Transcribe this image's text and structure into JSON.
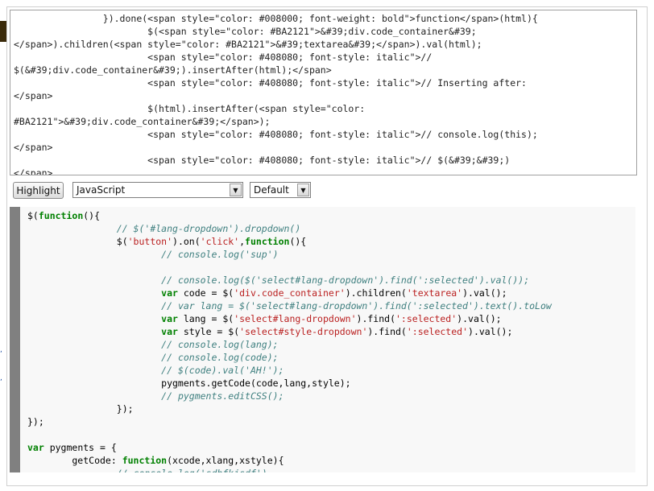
{
  "raw_html_lines": [
    "                }).done(<span style=\"color: #008000; font-weight: bold\">function</span>(html){",
    "                        $(<span style=\"color: #BA2121\">&#39;div.code_container&#39;",
    "</span>).children(<span style=\"color: #BA2121\">&#39;textarea&#39;</span>).val(html);",
    "                        <span style=\"color: #408080; font-style: italic\">//",
    "$(&#39;div.code_container&#39;).insertAfter(html);</span>",
    "                        <span style=\"color: #408080; font-style: italic\">// Inserting after:",
    "</span>",
    "                        $(html).insertAfter(<span style=\"color:",
    "#BA2121\">&#39;div.code_container&#39;</span>);",
    "                        <span style=\"color: #408080; font-style: italic\">// console.log(this);",
    "</span>",
    "                        <span style=\"color: #408080; font-style: italic\">// $(&#39;&#39;)",
    "</span>"
  ],
  "controls": {
    "highlight_label": "Highlight",
    "language_selected": "JavaScript",
    "style_selected": "Default"
  },
  "code_lines": [
    [
      {
        "t": "$("
      },
      {
        "t": "function",
        "c": "kw"
      },
      {
        "t": "(){"
      }
    ],
    [
      {
        "t": "                "
      },
      {
        "t": "// $('#lang-dropdown').dropdown()",
        "c": "cm"
      }
    ],
    [
      {
        "t": "                $("
      },
      {
        "t": "'button'",
        "c": "st"
      },
      {
        "t": ").on("
      },
      {
        "t": "'click'",
        "c": "st"
      },
      {
        "t": ","
      },
      {
        "t": "function",
        "c": "kw"
      },
      {
        "t": "(){"
      }
    ],
    [
      {
        "t": "                        "
      },
      {
        "t": "// console.log('sup')",
        "c": "cm"
      }
    ],
    [
      {
        "t": ""
      }
    ],
    [
      {
        "t": "                        "
      },
      {
        "t": "// console.log($('select#lang-dropdown').find(':selected').val());",
        "c": "cm"
      }
    ],
    [
      {
        "t": "                        "
      },
      {
        "t": "var",
        "c": "kw"
      },
      {
        "t": " code = $("
      },
      {
        "t": "'div.code_container'",
        "c": "st"
      },
      {
        "t": ").children("
      },
      {
        "t": "'textarea'",
        "c": "st"
      },
      {
        "t": ").val();"
      }
    ],
    [
      {
        "t": "                        "
      },
      {
        "t": "// var lang = $('select#lang-dropdown').find(':selected').text().toLow",
        "c": "cm"
      }
    ],
    [
      {
        "t": "                        "
      },
      {
        "t": "var",
        "c": "kw"
      },
      {
        "t": " lang = $("
      },
      {
        "t": "'select#lang-dropdown'",
        "c": "st"
      },
      {
        "t": ").find("
      },
      {
        "t": "':selected'",
        "c": "st"
      },
      {
        "t": ").val();"
      }
    ],
    [
      {
        "t": "                        "
      },
      {
        "t": "var",
        "c": "kw"
      },
      {
        "t": " style = $("
      },
      {
        "t": "'select#style-dropdown'",
        "c": "st"
      },
      {
        "t": ").find("
      },
      {
        "t": "':selected'",
        "c": "st"
      },
      {
        "t": ").val();"
      }
    ],
    [
      {
        "t": "                        "
      },
      {
        "t": "// console.log(lang);",
        "c": "cm"
      }
    ],
    [
      {
        "t": "                        "
      },
      {
        "t": "// console.log(code);",
        "c": "cm"
      }
    ],
    [
      {
        "t": "                        "
      },
      {
        "t": "// $(code).val('AH!');",
        "c": "cm"
      }
    ],
    [
      {
        "t": "                        pygments.getCode(code,lang,style);"
      }
    ],
    [
      {
        "t": "                        "
      },
      {
        "t": "// pygments.editCSS();",
        "c": "cm"
      }
    ],
    [
      {
        "t": "                });"
      }
    ],
    [
      {
        "t": "});"
      }
    ],
    [
      {
        "t": ""
      }
    ],
    [
      {
        "t": "var",
        "c": "kw"
      },
      {
        "t": " pygments = {"
      }
    ],
    [
      {
        "t": "        getCode: "
      },
      {
        "t": "function",
        "c": "kw"
      },
      {
        "t": "(xcode,xlang,xstyle){"
      }
    ],
    [
      {
        "t": "                "
      },
      {
        "t": "// console.log('sdhfkjsdf')",
        "c": "cm"
      }
    ]
  ]
}
